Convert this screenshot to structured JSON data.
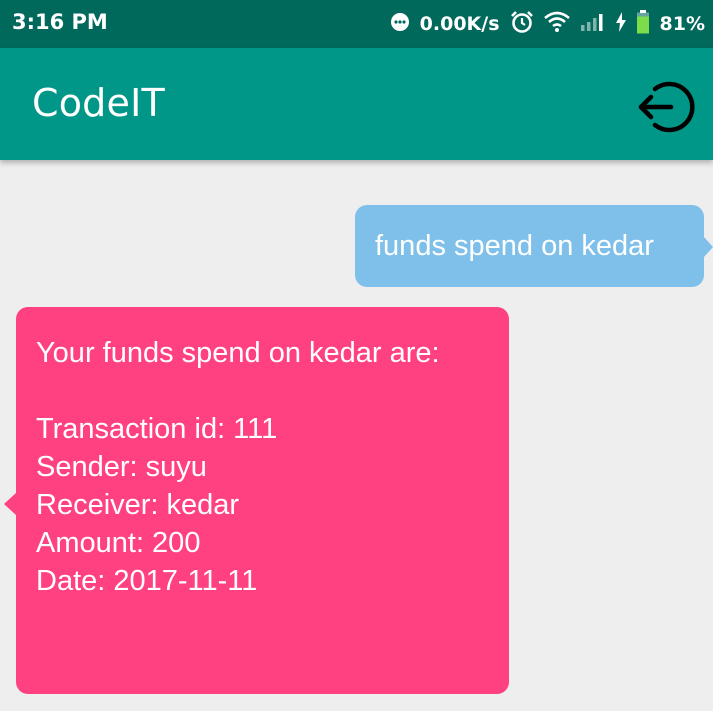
{
  "status_bar": {
    "time": "3:16 PM",
    "network_speed": "0.00K/s",
    "battery_percent": "81%",
    "icons": [
      "chat-bubble-icon",
      "alarm-clock-icon",
      "wifi-icon",
      "cellular-signal-icon",
      "charging-bolt-icon",
      "battery-icon"
    ],
    "battery_level": 0.81
  },
  "app_bar": {
    "title": "CodeIT",
    "logout_icon": "logout-icon",
    "color": "#009688"
  },
  "messages": [
    {
      "type": "sent",
      "text": "funds spend on kedar",
      "color": "#7fc0ea"
    },
    {
      "type": "received",
      "color": "#ff4081",
      "header": "Your funds spend on kedar are:",
      "lines": [
        "Transaction id: 111",
        "Sender: suyu",
        "Receiver: kedar",
        "Amount: 200",
        "Date: 2017-11-11"
      ]
    }
  ]
}
